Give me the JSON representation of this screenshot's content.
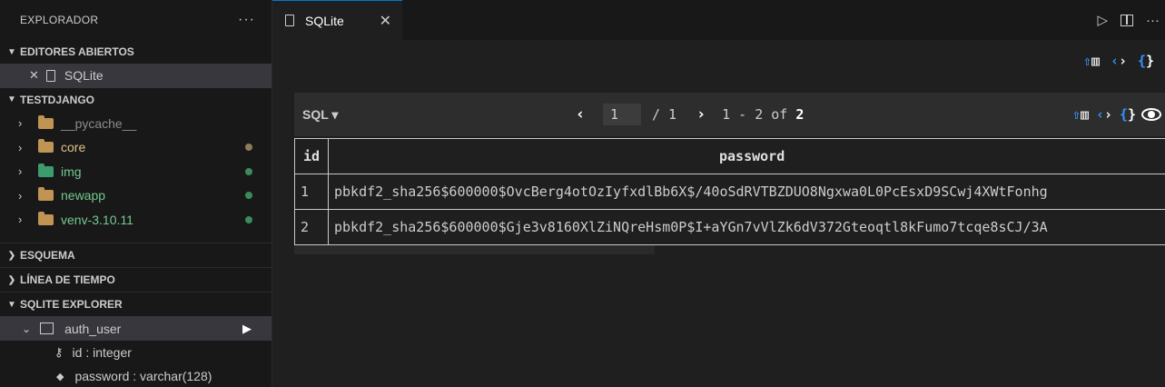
{
  "sidebar": {
    "title": "EXPLORADOR",
    "more": "···",
    "open_editors": {
      "label": "EDITORES ABIERTOS",
      "items": [
        {
          "close": "✕",
          "label": "SQLite"
        }
      ]
    },
    "project": {
      "label": "TESTDJANGO",
      "items": [
        {
          "label": "__pycache__",
          "color": "#8c8c8c",
          "dot": ""
        },
        {
          "label": "core",
          "color": "#e2c08d",
          "dot": "#8b7b5a"
        },
        {
          "label": "img",
          "color": "#73c991",
          "dot": "#3c8a5a"
        },
        {
          "label": "newapp",
          "color": "#73c991",
          "dot": "#3c8a5a"
        },
        {
          "label": "venv-3.10.11",
          "color": "#73c991",
          "dot": "#3c8a5a"
        }
      ]
    },
    "sections": [
      {
        "label": "ESQUEMA"
      },
      {
        "label": "LÍNEA DE TIEMPO"
      },
      {
        "label": "SQLITE EXPLORER"
      }
    ],
    "sqlite_explorer": {
      "table": "auth_user",
      "columns": [
        {
          "icon": "key-icon",
          "label": "id : integer"
        },
        {
          "icon": "diamond-icon",
          "label": "password : varchar(128)"
        }
      ]
    }
  },
  "editor": {
    "tab": {
      "label": "SQLite",
      "close": "✕"
    },
    "results": {
      "query_mode": "SQL ▾",
      "page_current": "1",
      "page_total": "/ 1",
      "range": "1 - 2 of",
      "total": "2",
      "columns": [
        "id",
        "password"
      ],
      "rows": [
        [
          "1",
          "pbkdf2_sha256$600000$OvcBerg4otOzIyfxdlBb6X$/40oSdRVTBZDUO8Ngxwa0L0PcEsxD9SCwj4XWtFonhg"
        ],
        [
          "2",
          "pbkdf2_sha256$600000$Gje3v8160XlZiNQreHsm0P$I+aYGn7vVlZk6dV372Gteoqtl8kFumo7tcqe8sCJ/3A"
        ]
      ]
    }
  },
  "colors": {
    "accent": "#0078d4",
    "icon_blue": "#3794ff"
  }
}
